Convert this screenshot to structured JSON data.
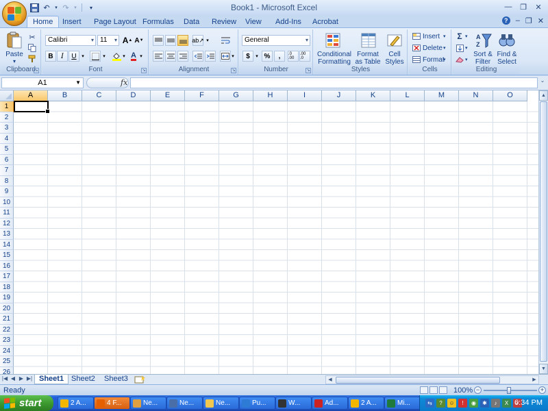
{
  "window": {
    "title": "Book1 - Microsoft Excel"
  },
  "qat": {
    "save_icon": "save-icon",
    "undo_icon": "undo-icon",
    "redo_icon": "redo-icon"
  },
  "tabs": [
    {
      "label": "Home",
      "active": true
    },
    {
      "label": "Insert"
    },
    {
      "label": "Page Layout"
    },
    {
      "label": "Formulas"
    },
    {
      "label": "Data"
    },
    {
      "label": "Review"
    },
    {
      "label": "View"
    },
    {
      "label": "Add-Ins"
    },
    {
      "label": "Acrobat"
    }
  ],
  "ribbon": {
    "clipboard": {
      "label": "Clipboard",
      "paste": "Paste"
    },
    "font": {
      "label": "Font",
      "family": "Calibri",
      "size": "11",
      "bold": "B",
      "italic": "I",
      "underline": "U"
    },
    "alignment": {
      "label": "Alignment"
    },
    "number": {
      "label": "Number",
      "format": "General",
      "currency": "$",
      "percent": "%",
      "comma": ",",
      "inc_dec": ".0 .00",
      "dec_dec": ".00 .0"
    },
    "styles": {
      "label": "Styles",
      "conditional_1": "Conditional",
      "conditional_2": "Formatting",
      "format_table_1": "Format",
      "format_table_2": "as Table",
      "cell_styles_1": "Cell",
      "cell_styles_2": "Styles"
    },
    "cells": {
      "label": "Cells",
      "insert": "Insert",
      "delete": "Delete",
      "format": "Format"
    },
    "editing": {
      "label": "Editing",
      "sigma": "Σ",
      "sort_1": "Sort &",
      "sort_2": "Filter",
      "find_1": "Find &",
      "find_2": "Select"
    }
  },
  "formula_bar": {
    "name_box": "A1",
    "fx": "fx",
    "value": ""
  },
  "grid": {
    "columns": [
      "A",
      "B",
      "C",
      "D",
      "E",
      "F",
      "G",
      "H",
      "I",
      "J",
      "K",
      "L",
      "M",
      "N",
      "O"
    ],
    "rows": [
      "1",
      "2",
      "3",
      "4",
      "5",
      "6",
      "7",
      "8",
      "9",
      "10",
      "11",
      "12",
      "13",
      "14",
      "15",
      "16",
      "17",
      "18",
      "19",
      "20",
      "21",
      "22",
      "23",
      "24",
      "25",
      "26"
    ],
    "active_cell": "A1"
  },
  "sheets": [
    {
      "label": "Sheet1",
      "active": true
    },
    {
      "label": "Sheet2"
    },
    {
      "label": "Sheet3"
    }
  ],
  "status": {
    "text": "Ready",
    "zoom": "100%"
  },
  "taskbar": {
    "start": "start",
    "tasks": [
      {
        "label": "2 A...",
        "icon": "aim-icon",
        "color": "#f2b600"
      },
      {
        "label": "4 F...",
        "icon": "firefox-icon",
        "color": "#e66000",
        "hot": true
      },
      {
        "label": "Ne...",
        "icon": "window-icon",
        "color": "#e0a040"
      },
      {
        "label": "Ne...",
        "icon": "network-icon",
        "color": "#4a6fa8"
      },
      {
        "label": "Ne...",
        "icon": "folder-icon",
        "color": "#f0c850"
      },
      {
        "label": "Pu...",
        "icon": "publisher-icon",
        "color": "#2e7bd6"
      },
      {
        "label": "W...",
        "icon": "winamp-icon",
        "color": "#333333"
      },
      {
        "label": "Ad...",
        "icon": "acrobat-icon",
        "color": "#cc2222"
      },
      {
        "label": "2 A...",
        "icon": "aim-icon",
        "color": "#f2b600"
      },
      {
        "label": "Mi...",
        "icon": "excel-icon",
        "color": "#1f7a3d"
      }
    ],
    "clock": "6:34 PM"
  }
}
